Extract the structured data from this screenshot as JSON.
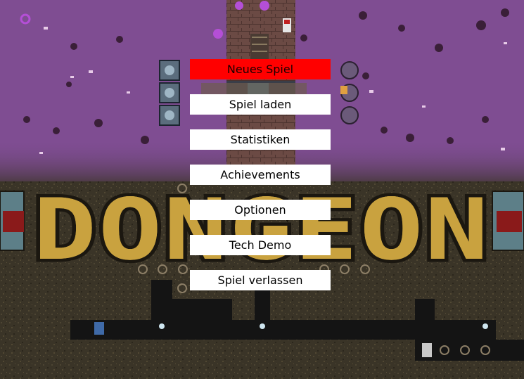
{
  "game": {
    "logo_text": "DONGEON",
    "colors": {
      "sky": "#7b4a8e",
      "ground": "#3a3427",
      "logo_fill": "#c9a23f",
      "logo_outline": "#1b1710",
      "selected_button": "#ff0000",
      "button": "#ffffff"
    }
  },
  "menu": {
    "items": [
      {
        "label": "Neues Spiel",
        "selected": true
      },
      {
        "label": "Spiel laden",
        "selected": false
      },
      {
        "label": "Statistiken",
        "selected": false
      },
      {
        "label": "Achievements",
        "selected": false
      },
      {
        "label": "Optionen",
        "selected": false
      },
      {
        "label": "Tech Demo",
        "selected": false
      },
      {
        "label": "Spiel verlassen",
        "selected": false
      }
    ]
  }
}
